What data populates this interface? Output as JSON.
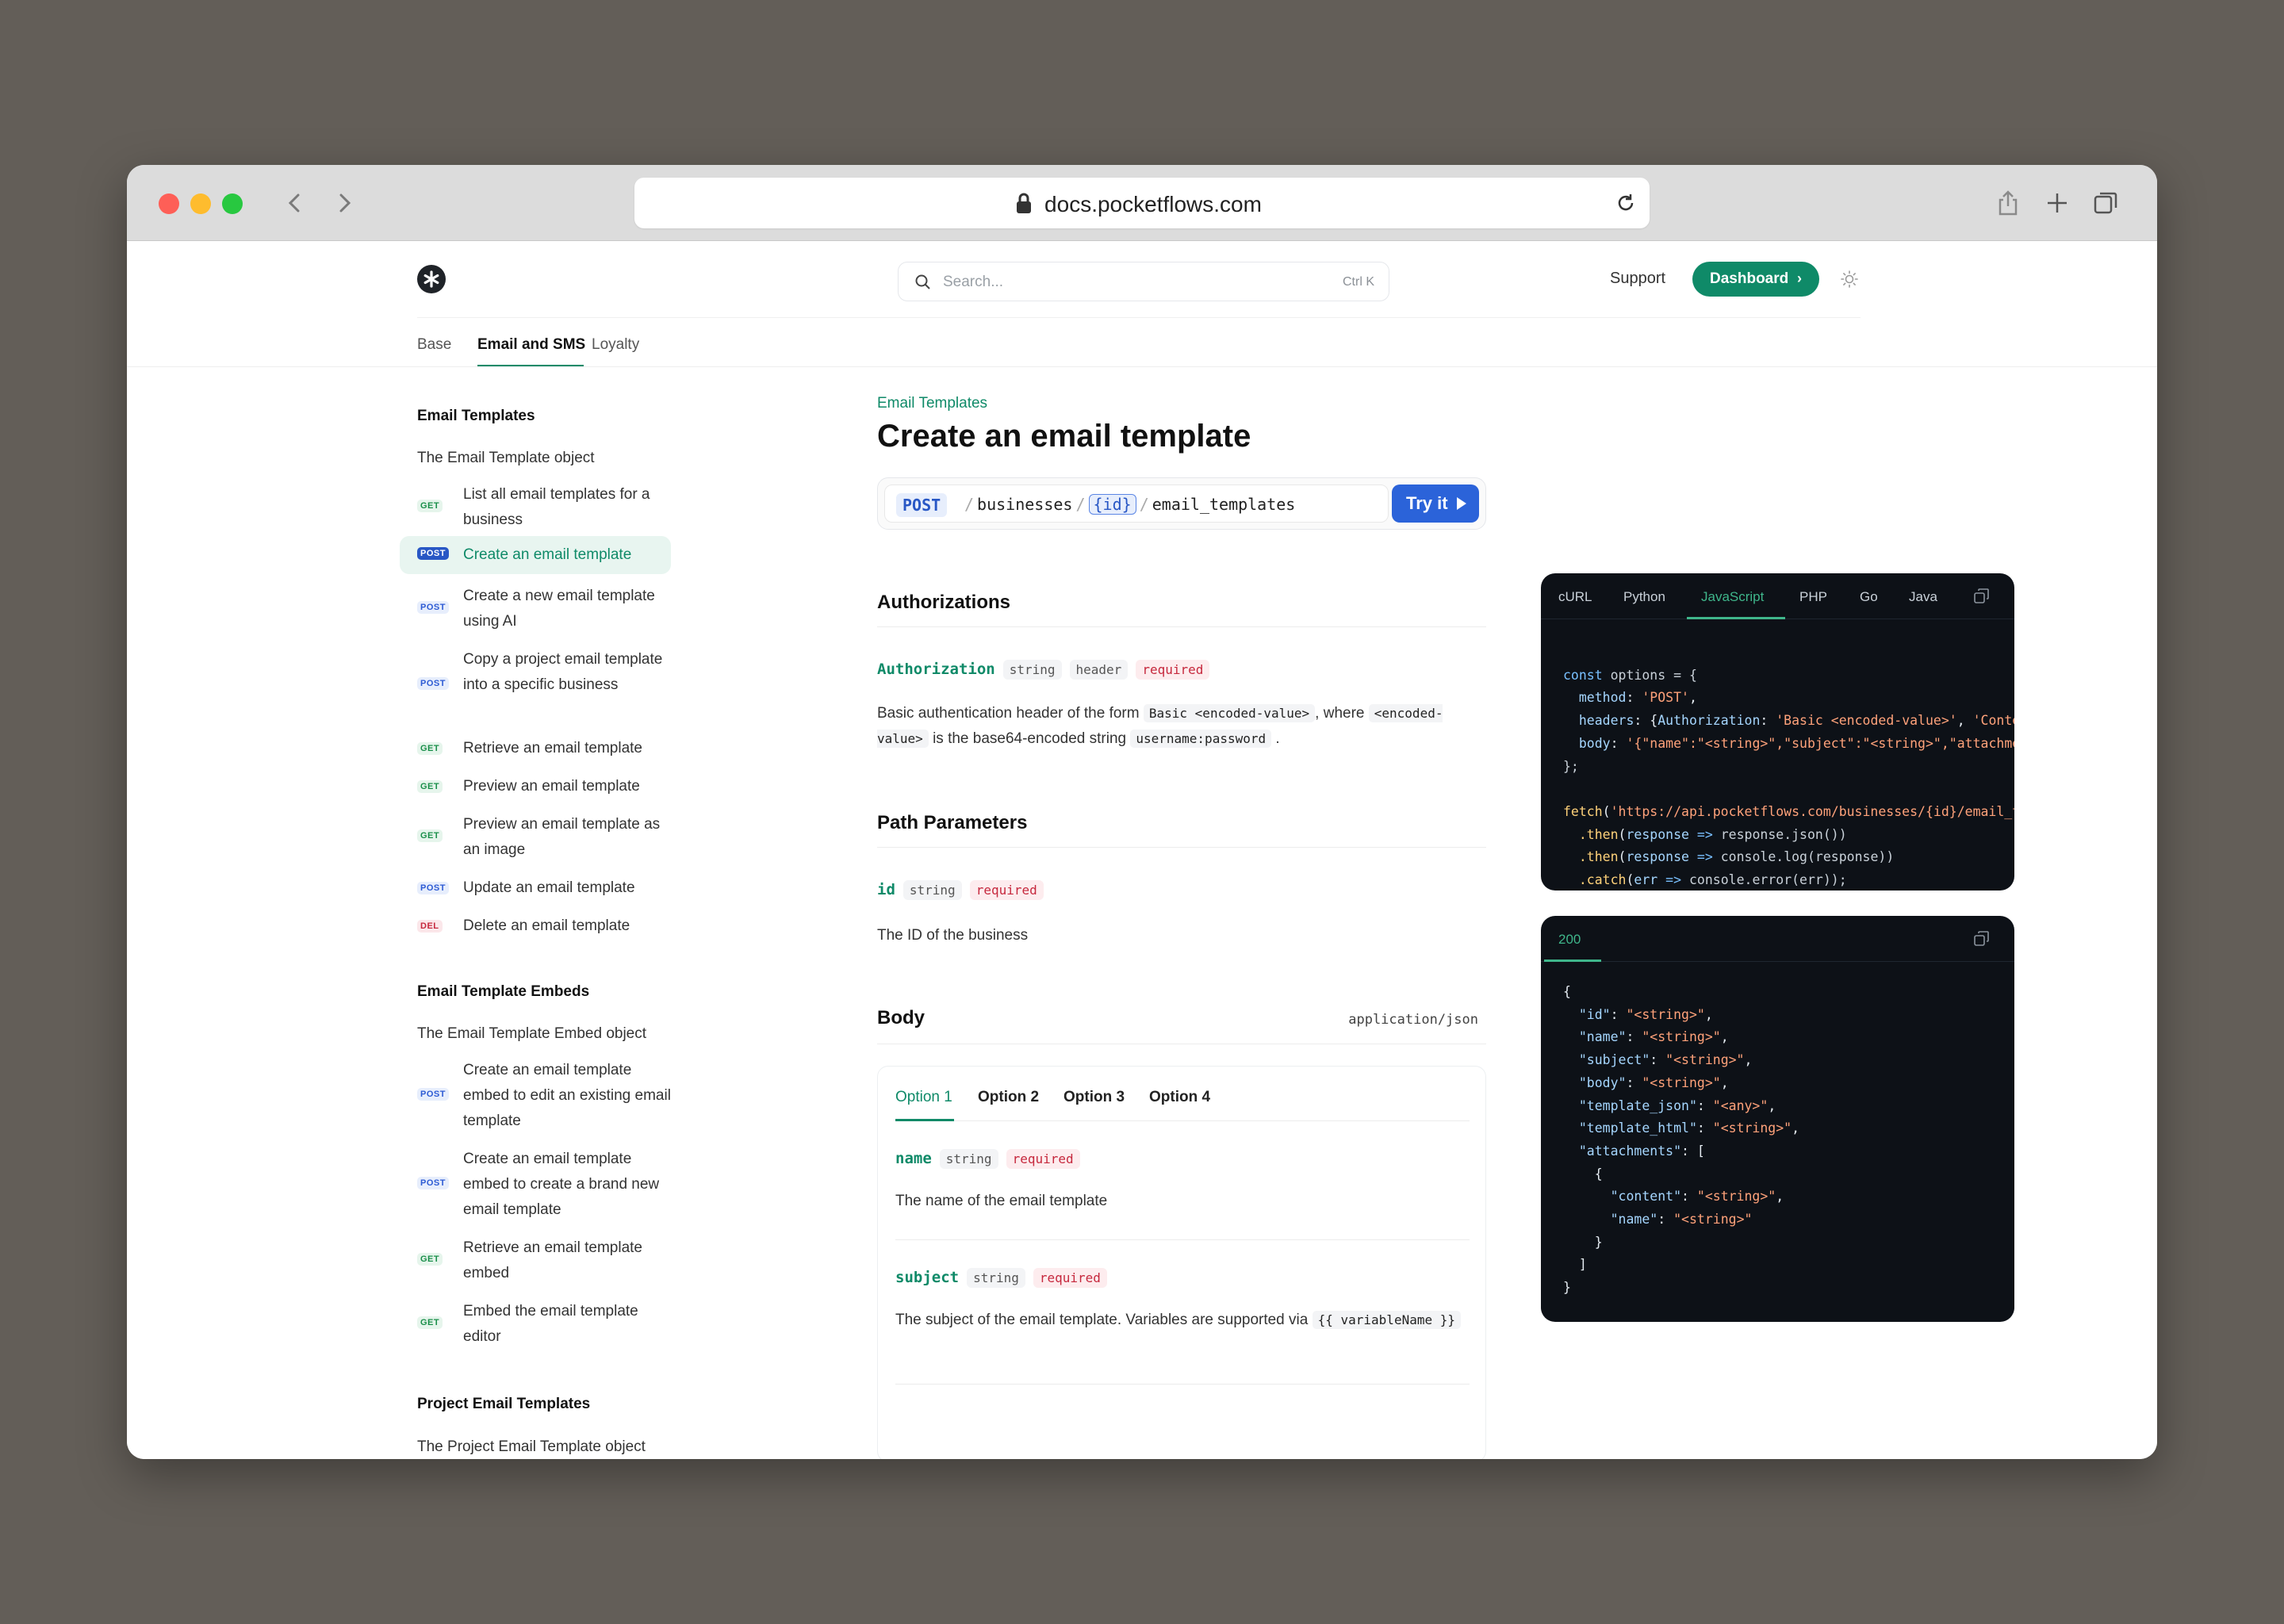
{
  "browser": {
    "url": "docs.pocketflows.com"
  },
  "header": {
    "search_placeholder": "Search...",
    "search_shortcut": "Ctrl K",
    "support_label": "Support",
    "dashboard_label": "Dashboard"
  },
  "top_tabs": [
    "Base",
    "Email and SMS",
    "Loyalty"
  ],
  "sidebar": {
    "group1": "Email Templates",
    "group1_object": "The Email Template object",
    "group1_items": [
      {
        "method": "GET",
        "label": "List all email templates for a business"
      },
      {
        "method": "POST",
        "label": "Create an email template",
        "active": true
      },
      {
        "method": "POST",
        "label": "Create a new email template using AI"
      },
      {
        "method": "POST",
        "label": "Copy a project email template into a specific business"
      },
      {
        "method": "GET",
        "label": "Retrieve an email template"
      },
      {
        "method": "GET",
        "label": "Preview an email template"
      },
      {
        "method": "GET",
        "label": "Preview an email template as an image"
      },
      {
        "method": "POST",
        "label": "Update an email template"
      },
      {
        "method": "DEL",
        "label": "Delete an email template"
      }
    ],
    "group2": "Email Template Embeds",
    "group2_object": "The Email Template Embed object",
    "group2_items": [
      {
        "method": "POST",
        "label": "Create an email template embed to edit an existing email template"
      },
      {
        "method": "POST",
        "label": "Create an email template embed to create a brand new email template"
      },
      {
        "method": "GET",
        "label": "Retrieve an email template embed"
      },
      {
        "method": "GET",
        "label": "Embed the email template editor"
      }
    ],
    "group3": "Project Email Templates",
    "group3_object": "The Project Email Template object"
  },
  "main": {
    "breadcrumb": "Email Templates",
    "title": "Create an email template",
    "endpoint": {
      "method": "POST",
      "seg1": "businesses",
      "param": "{id}",
      "seg2": "email_templates",
      "try_label": "Try it"
    },
    "authorizations": {
      "heading": "Authorizations",
      "name": "Authorization",
      "type": "string",
      "location": "header",
      "required": "required",
      "desc_1": "Basic authentication header of the form",
      "code_1": "Basic <encoded-value>",
      "desc_2": ", where",
      "code_2": "<encoded-value>",
      "desc_3": "is the base64-encoded string",
      "code_3": "username:password",
      "desc_4": "."
    },
    "path_params": {
      "heading": "Path Parameters",
      "name": "id",
      "type": "string",
      "required": "required",
      "desc": "The ID of the business"
    },
    "body": {
      "heading": "Body",
      "content_type": "application/json",
      "options": [
        "Option 1",
        "Option 2",
        "Option 3",
        "Option 4"
      ],
      "fields": [
        {
          "name": "name",
          "type": "string",
          "required": "required",
          "desc": "The name of the email template"
        },
        {
          "name": "subject",
          "type": "string",
          "required": "required",
          "desc": "The subject of the email template. Variables are supported via",
          "code": "{{ variableName }}"
        }
      ]
    }
  },
  "request_panel": {
    "tabs": [
      "cURL",
      "Python",
      "JavaScript",
      "PHP",
      "Go",
      "Java"
    ],
    "active_tab": "JavaScript",
    "code": {
      "l1_kw": "const",
      "l1_var": "options",
      "l1_rest": " = {",
      "l2_key": "method",
      "l2_val": "'POST'",
      "l3_key": "headers",
      "l3_inner_key": "Authorization",
      "l3_val": "'Basic <encoded-value>'",
      "l3_val2": "'Conten",
      "l4_key": "body",
      "l4_val": "'{\"name\":\"<string>\",\"subject\":\"<string>\",\"attachmen",
      "l5": "};",
      "l7_fn": "fetch",
      "l7_url": "'https://api.pocketflows.com/businesses/{id}/email_te",
      "l8_fn": ".then",
      "l8_arg": "response",
      "l8_rest": "response.json())",
      "l9_fn": ".then",
      "l9_arg": "response",
      "l9_rest": "console.log(response))",
      "l10_fn": ".catch",
      "l10_arg": "err",
      "l10_rest": "console.error(err));"
    }
  },
  "response_panel": {
    "status": "200",
    "lines": [
      "{",
      "  \"id\": \"<string>\",",
      "  \"name\": \"<string>\",",
      "  \"subject\": \"<string>\",",
      "  \"body\": \"<string>\",",
      "  \"template_json\": \"<any>\",",
      "  \"template_html\": \"<string>\",",
      "  \"attachments\": [",
      "    {",
      "      \"content\": \"<string>\",",
      "      \"name\": \"<string>\"",
      "    }",
      "  ]",
      "}"
    ]
  },
  "colors": {
    "brand": "#0f8a68",
    "post": "#2857c5",
    "get": "#1a8f4a",
    "del": "#c6283d",
    "code_bg": "#0d1117"
  }
}
